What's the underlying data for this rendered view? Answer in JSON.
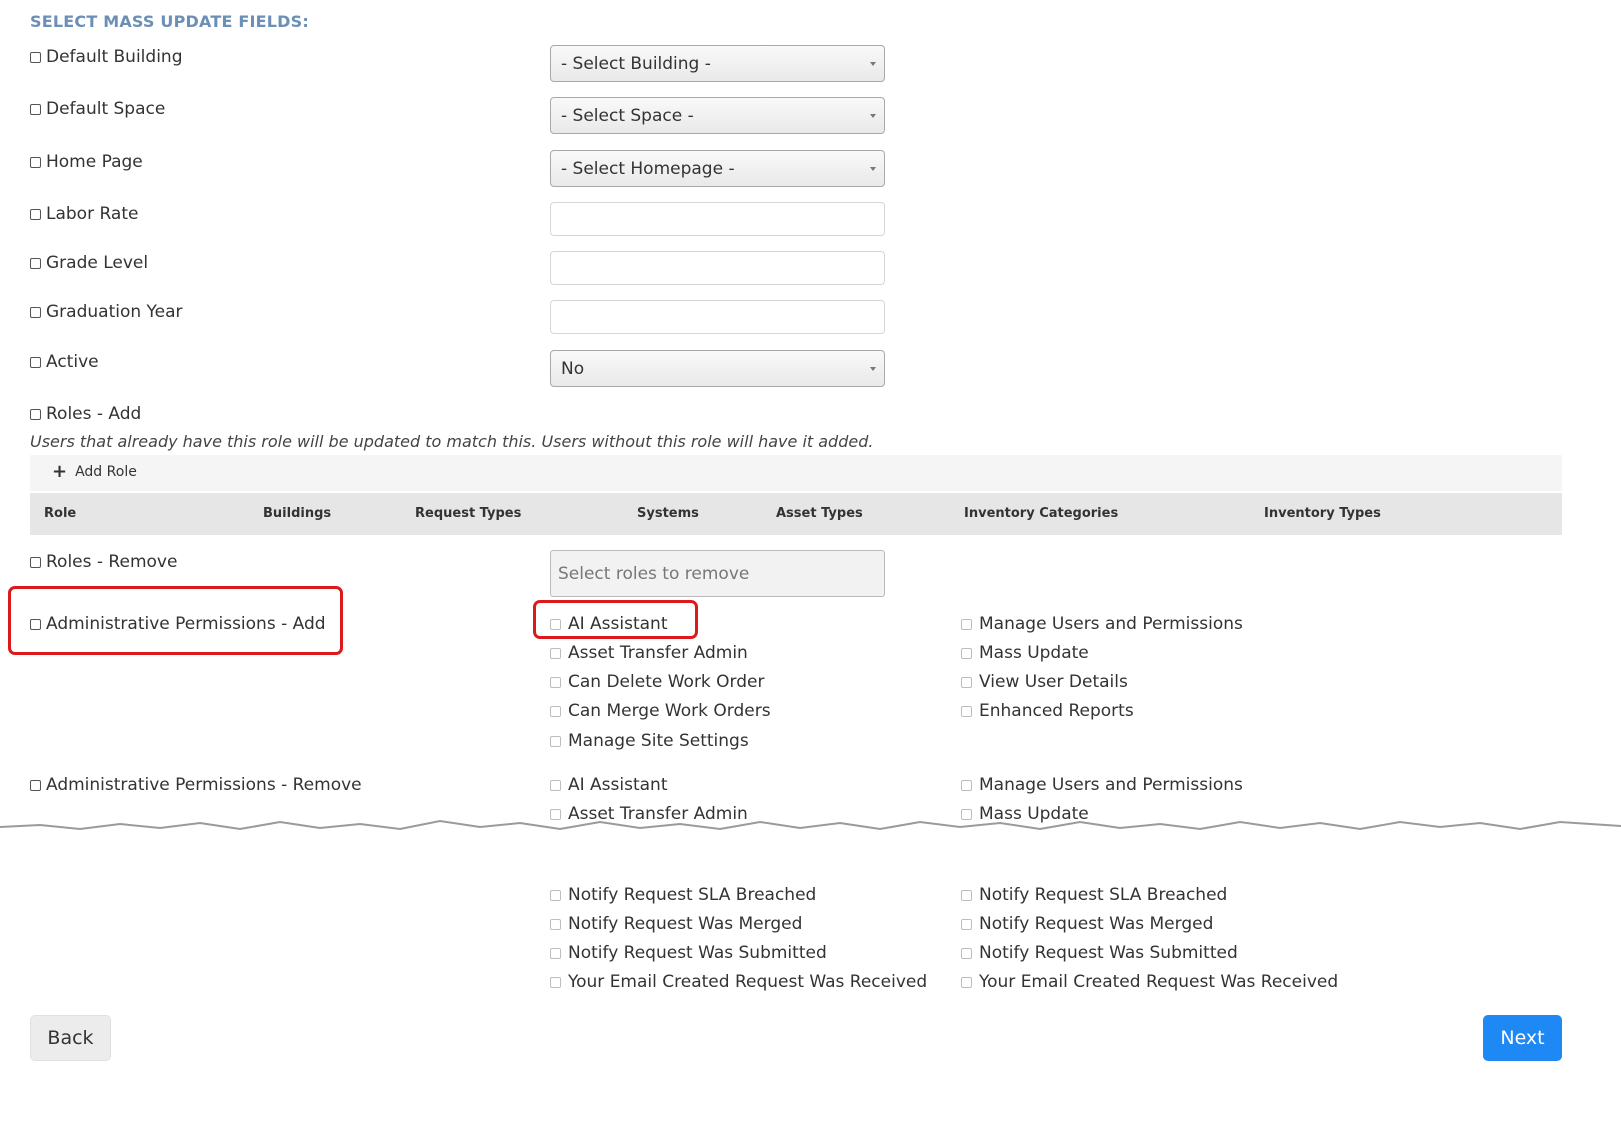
{
  "title": "SELECT MASS UPDATE FIELDS:",
  "fields": {
    "default_building": {
      "label": "Default Building",
      "value": "- Select Building -"
    },
    "default_space": {
      "label": "Default Space",
      "value": "- Select Space -"
    },
    "home_page": {
      "label": "Home Page",
      "value": "- Select Homepage -"
    },
    "labor_rate": {
      "label": "Labor Rate",
      "value": ""
    },
    "grade_level": {
      "label": "Grade Level",
      "value": ""
    },
    "graduation_year": {
      "label": "Graduation Year",
      "value": ""
    },
    "active": {
      "label": "Active",
      "value": "No"
    }
  },
  "roles_add": {
    "label": "Roles - Add",
    "note": "Users that already have this role will be updated to match this. Users without this role will have it added.",
    "add_role_label": "Add Role",
    "columns": [
      "Role",
      "Buildings",
      "Request Types",
      "Systems",
      "Asset Types",
      "Inventory Categories",
      "Inventory Types"
    ]
  },
  "roles_remove": {
    "label": "Roles - Remove",
    "placeholder": "Select roles to remove"
  },
  "admin_add": {
    "label": "Administrative Permissions - Add",
    "col1": [
      "AI Assistant",
      "Asset Transfer Admin",
      "Can Delete Work Order",
      "Can Merge Work Orders",
      "Manage Site Settings"
    ],
    "col2": [
      "Manage Users and Permissions",
      "Mass Update",
      "View User Details",
      "Enhanced Reports"
    ]
  },
  "admin_remove": {
    "label": "Administrative Permissions - Remove",
    "col1": [
      "AI Assistant",
      "Asset Transfer Admin"
    ],
    "col2": [
      "Manage Users and Permissions",
      "Mass Update"
    ]
  },
  "notifications": {
    "col1": [
      "Notify Request SLA Breached",
      "Notify Request Was Merged",
      "Notify Request Was Submitted",
      "Your Email Created Request Was Received"
    ],
    "col2": [
      "Notify Request SLA Breached",
      "Notify Request Was Merged",
      "Notify Request Was Submitted",
      "Your Email Created Request Was Received"
    ]
  },
  "buttons": {
    "back": "Back",
    "next": "Next"
  },
  "colors": {
    "title": "#6b8fb5",
    "highlight": "#dd1a1a",
    "primary": "#1e88f5"
  }
}
